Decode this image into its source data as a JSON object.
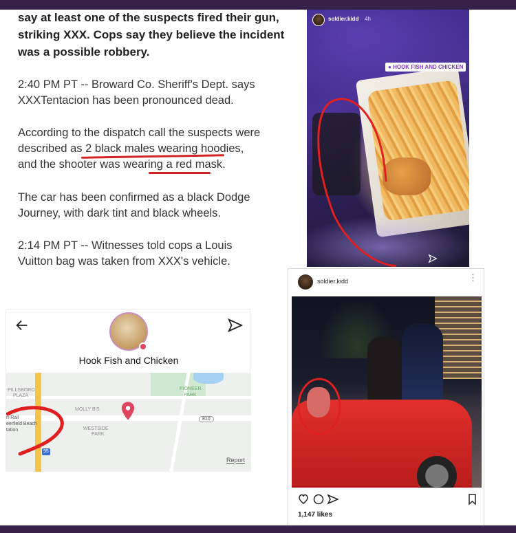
{
  "article": {
    "p1_line1": "say at least one of the suspects fired their gun,",
    "p1_line2": "striking XXX. Cops say they believe the incident",
    "p1_line3": "was a possible robbery.",
    "p2_line1": "2:40 PM PT -- Broward Co. Sheriff's Dept. says",
    "p2_line2": "XXXTentacion has been pronounced dead.",
    "p3_line1": "According to the dispatch call the suspects were",
    "p3_line2": "described as 2 black males wearing hoodies,",
    "p3_line3": "and the shooter was wearing a red mask.",
    "p4_line1": "The car has been confirmed as a black Dodge",
    "p4_line2": "Journey, with dark tint and black wheels.",
    "p5_line1": "2:14 PM PT -- Witnesses told cops a Louis",
    "p5_line2": "Vuitton bag was taken from XXX's vehicle."
  },
  "story": {
    "username": "soldier.kidd",
    "time": "4h",
    "location_tag": "HOOK FISH AND CHICKEN"
  },
  "post": {
    "username": "soldier.kidd",
    "likes": "1,147 likes"
  },
  "map": {
    "place_name": "Hook Fish and Chicken",
    "labels": {
      "pillsboro": "PILLSBORO",
      "plaza": "PLAZA",
      "pioneer": "Pioneer",
      "park": "Park",
      "molly": "MOLLY B'S",
      "westside": "WESTSIDE",
      "westside_park": "PARK",
      "rail1": "ri-Rail",
      "rail2": "eerfield Beach",
      "rail3": "tation",
      "route": "810",
      "route95": "95"
    },
    "report": "Report"
  },
  "colors": {
    "frame": "#34224a",
    "annotation_red": "#d22222",
    "tag_purple": "#7a3ab8"
  }
}
